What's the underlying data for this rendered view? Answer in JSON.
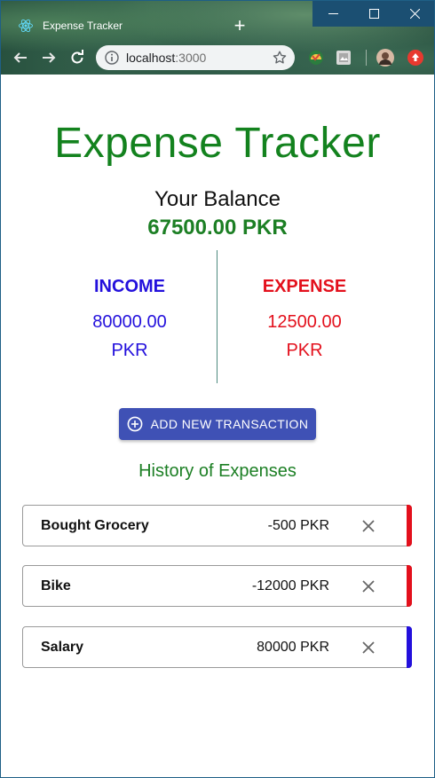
{
  "browser": {
    "tab_title": "Expense Tracker",
    "url_host": "localhost",
    "url_port": ":3000"
  },
  "app": {
    "title": "Expense Tracker",
    "balance_label": "Your Balance",
    "balance_value": "67500.00 PKR",
    "income": {
      "label": "INCOME",
      "amount": "80000.00",
      "currency": "PKR",
      "color": "#2310dc"
    },
    "expense": {
      "label": "EXPENSE",
      "amount": "12500.00",
      "currency": "PKR",
      "color": "#e3101c"
    },
    "add_button_label": "ADD NEW TRANSACTION",
    "history_title": "History of Expenses",
    "transactions": [
      {
        "name": "Bought Grocery",
        "amount": "-500 PKR",
        "type": "expense",
        "bar_color": "#e3101c"
      },
      {
        "name": "Bike",
        "amount": "-12000 PKR",
        "type": "expense",
        "bar_color": "#e3101c"
      },
      {
        "name": "Salary",
        "amount": "80000 PKR",
        "type": "income",
        "bar_color": "#2310dc"
      }
    ]
  },
  "colors": {
    "title_green": "#13821e",
    "button_blue": "#3f51b5"
  },
  "icons": [
    "react-icon",
    "new-tab-icon",
    "minimize-icon",
    "maximize-icon",
    "close-icon",
    "back-icon",
    "forward-icon",
    "reload-icon",
    "info-icon",
    "star-icon",
    "extension-icon",
    "profile-avatar",
    "update-icon",
    "add-circle-icon",
    "delete-icon"
  ]
}
